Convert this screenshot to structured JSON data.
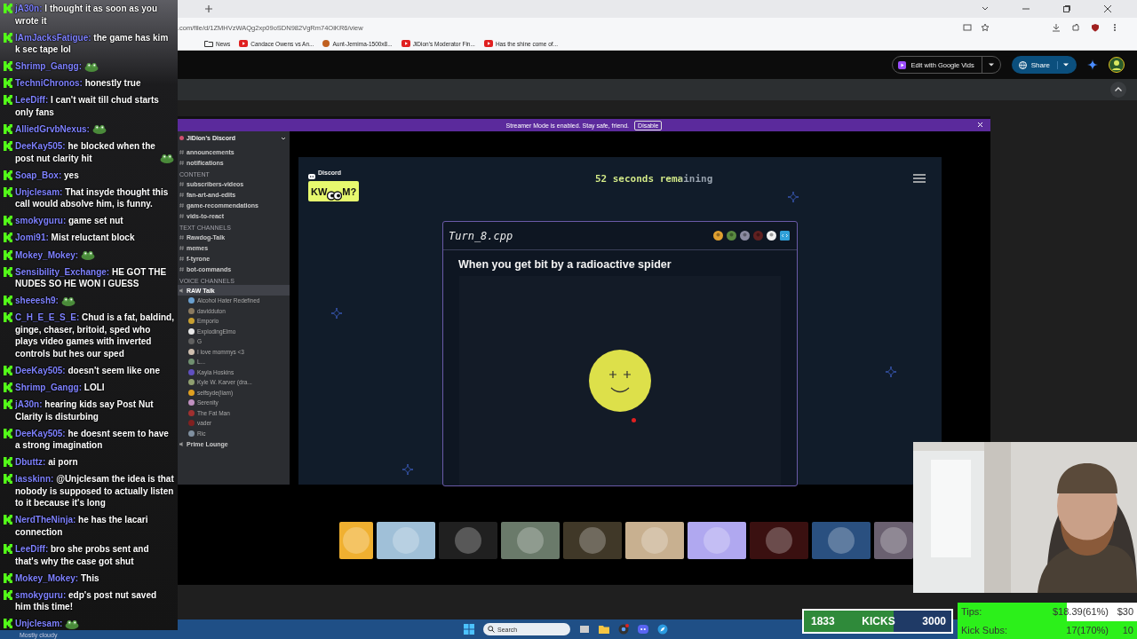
{
  "browser": {
    "url": ".com/file/d/1ZMHVzWAQg2xp09oSDN982VgRm74OiKR6/view",
    "bookmarks": [
      {
        "kind": "folder",
        "label": "News"
      },
      {
        "kind": "video",
        "label": "Candace Owens vs An..."
      },
      {
        "kind": "site",
        "label": "Aunt-Jemima-1500x8..."
      },
      {
        "kind": "video",
        "label": "JiDion's Moderator Fin..."
      },
      {
        "kind": "video",
        "label": "Has the shine come of..."
      }
    ]
  },
  "drive": {
    "edit_button": "Edit with Google Vids",
    "share_button": "Share"
  },
  "streamer_banner": {
    "text": "Streamer Mode is enabled. Stay safe, friend.",
    "button": "Disable"
  },
  "discord_sidebar": {
    "server": "JiDion's Discord",
    "items": [
      {
        "kind": "channel",
        "label": "announcements",
        "selected": false
      },
      {
        "kind": "channel",
        "label": "notifications",
        "selected": false
      },
      {
        "kind": "category",
        "label": "CONTENT"
      },
      {
        "kind": "channel",
        "label": "subscribers-videos",
        "selected": false
      },
      {
        "kind": "channel",
        "label": "fan-art-and-edits",
        "selected": false
      },
      {
        "kind": "channel",
        "label": "game-recommendations",
        "selected": false
      },
      {
        "kind": "channel",
        "label": "vids-to-react",
        "selected": false
      },
      {
        "kind": "category",
        "label": "TEXT CHANNELS"
      },
      {
        "kind": "channel",
        "label": "Rawdog-Talk",
        "selected": false
      },
      {
        "kind": "channel",
        "label": "memes",
        "selected": false
      },
      {
        "kind": "channel",
        "label": "f-tyrone",
        "selected": false
      },
      {
        "kind": "channel",
        "label": "bot-commands",
        "selected": false
      },
      {
        "kind": "category",
        "label": "VOICE CHANNELS"
      },
      {
        "kind": "voice",
        "label": "RAW Talk",
        "selected": true
      },
      {
        "kind": "user",
        "label": "Alcohol Hater Redefined",
        "color": "#6aa0d0"
      },
      {
        "kind": "user",
        "label": "davidduton",
        "color": "#8a7a60"
      },
      {
        "kind": "user",
        "label": "Emporio",
        "color": "#c8a030"
      },
      {
        "kind": "user",
        "label": "ExplodingElmo",
        "color": "#e8e8e8"
      },
      {
        "kind": "user",
        "label": "G",
        "color": "#606060"
      },
      {
        "kind": "user",
        "label": "I love mommys <3",
        "color": "#d0c0b0"
      },
      {
        "kind": "user",
        "label": "L...",
        "color": "#709070"
      },
      {
        "kind": "user",
        "label": "Kayla Hoskins",
        "color": "#6050c0"
      },
      {
        "kind": "user",
        "label": "Kyle W. Karver (dra...",
        "color": "#90a070"
      },
      {
        "kind": "user",
        "label": "selfsyde(liam)",
        "color": "#e0a020"
      },
      {
        "kind": "user",
        "label": "Serenity",
        "color": "#c090c0"
      },
      {
        "kind": "user",
        "label": "The Fat Man",
        "color": "#a03030"
      },
      {
        "kind": "user",
        "label": "vader",
        "color": "#802020"
      },
      {
        "kind": "user",
        "label": "Ric",
        "color": "#8090a0"
      },
      {
        "kind": "voice",
        "label": "Prime Lounge",
        "selected": false
      }
    ]
  },
  "game": {
    "brand": "Discord",
    "logo_start": "KW",
    "logo_end": "M?",
    "timer": "52 seconds remaining",
    "card": {
      "file": "Turn_8.cpp",
      "prompt": "When you get bit by a radioactive spider",
      "players": [
        {
          "color": "#e0a030"
        },
        {
          "color": "#5a8a40"
        },
        {
          "color": "#8a8aa0"
        },
        {
          "color": "#602020"
        },
        {
          "color": "#f0f0f0"
        },
        {
          "color": "#30a0d8"
        }
      ]
    }
  },
  "participants": [
    {
      "color": "#f0b030"
    },
    {
      "color": "#a0c0d8"
    },
    {
      "color": "#202020"
    },
    {
      "color": "#6a7a6a"
    },
    {
      "color": "#403828"
    },
    {
      "color": "#c8b090"
    },
    {
      "color": "#b0a8f0"
    },
    {
      "color": "#3a1010"
    },
    {
      "color": "#2a5080"
    },
    {
      "color": "#6a6070"
    }
  ],
  "chat": [
    {
      "user": "jA30n:",
      "text": "I thought it as soon as you wrote it"
    },
    {
      "user": "IAmJacksFatigue:",
      "text": "the game has kim k sec tape lol"
    },
    {
      "user": "Shrimp_Gangg:",
      "emote": true
    },
    {
      "user": "TechniChronos:",
      "text": "honestly true"
    },
    {
      "user": "LeeDiff:",
      "text": "I can't wait till chud starts only fans"
    },
    {
      "user": "AlliedGrvbNexus:",
      "emote": true
    },
    {
      "user": "DeeKay505:",
      "text": "he blocked when the post nut clarity hit",
      "emote": true
    },
    {
      "user": "Soap_Box:",
      "text": "yes"
    },
    {
      "user": "Unjclesam:",
      "text": "That insyde thought this call would absolve him, is funny."
    },
    {
      "user": "smokyguru:",
      "text": "game set nut"
    },
    {
      "user": "Jomi91:",
      "text": "Mist reluctant block"
    },
    {
      "user": "Mokey_Mokey:",
      "emote": true
    },
    {
      "user": "Sensibility_Exchange:",
      "text": "HE GOT THE NUDES SO HE WON I GUESS"
    },
    {
      "user": "sheeesh9:",
      "emote": true
    },
    {
      "user": "C_H_E_E_S_E:",
      "text": "Chud is a fat, baldind, ginge, chaser, britoid, sped who plays video games with inverted controls but hes our sped"
    },
    {
      "user": "DeeKay505:",
      "text": "doesn't seem like one"
    },
    {
      "user": "Shrimp_Gangg:",
      "text": "LOLI"
    },
    {
      "user": "jA30n:",
      "text": "hearing kids say Post Nut Clarity is disturbing"
    },
    {
      "user": "DeeKay505:",
      "text": "he doesnt seem to have a strong imagination"
    },
    {
      "user": "Dbuttz:",
      "text": "ai porn"
    },
    {
      "user": "lasskinn:",
      "text": "@Unjclesam the idea is that nobody is supposed to actually listen to it because it's long"
    },
    {
      "user": "NerdTheNinja:",
      "text": "he has the lacari connection"
    },
    {
      "user": "LeeDiff:",
      "text": "bro she probs sent and that's why the case got shut"
    },
    {
      "user": "Mokey_Mokey:",
      "text": "This"
    },
    {
      "user": "smokyguru:",
      "text": "edp's post nut saved him this time!"
    },
    {
      "user": "Unjclesam:",
      "emote": true
    }
  ],
  "weather": "Mostly cloudy",
  "taskbar": {
    "search": {
      "placeholder": "Search"
    }
  },
  "kicks": {
    "count": "1833",
    "label": "KICKS",
    "goal": "3000",
    "level": 0.611
  },
  "goals": [
    {
      "label": "Tips:",
      "value": "$18.39(61%)",
      "target": "$30",
      "level": 0.61
    },
    {
      "label": "Kick Subs:",
      "value": "17(170%)",
      "target": "10",
      "level": 1
    }
  ]
}
